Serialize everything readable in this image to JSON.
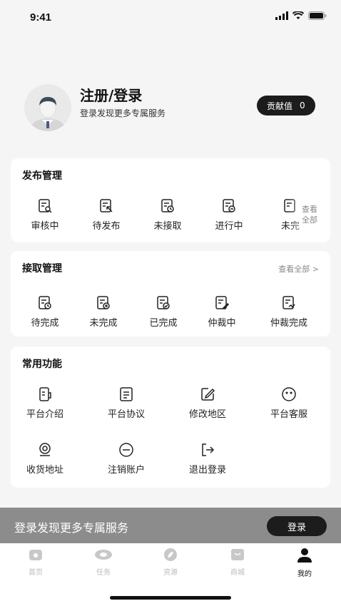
{
  "status_bar": {
    "time": "9:41"
  },
  "profile": {
    "title": "注册/登录",
    "subtitle": "登录发现更多专属服务",
    "contribution_label": "贡献值",
    "contribution_value": "0"
  },
  "publish": {
    "title": "发布管理",
    "side_more": [
      "查看",
      "全部"
    ],
    "items": [
      {
        "label": "审核中",
        "icon": "doc-search-icon"
      },
      {
        "label": "待发布",
        "icon": "doc-cursor-icon"
      },
      {
        "label": "未接取",
        "icon": "doc-clock-icon"
      },
      {
        "label": "进行中",
        "icon": "doc-progress-icon"
      },
      {
        "label": "未完",
        "icon": "doc-icon"
      }
    ]
  },
  "receive": {
    "title": "接取管理",
    "more": "查看全部 >",
    "items": [
      {
        "label": "待完成",
        "icon": "doc-clock-icon"
      },
      {
        "label": "未完成",
        "icon": "doc-x-icon"
      },
      {
        "label": "已完成",
        "icon": "doc-check-icon"
      },
      {
        "label": "仲裁中",
        "icon": "doc-edit-icon"
      },
      {
        "label": "仲裁完成",
        "icon": "doc-signed-icon"
      }
    ]
  },
  "common": {
    "title": "常用功能",
    "items": [
      {
        "label": "平台介绍",
        "icon": "info-doc-icon"
      },
      {
        "label": "平台协议",
        "icon": "agreement-icon"
      },
      {
        "label": "修改地区",
        "icon": "edit-icon"
      },
      {
        "label": "平台客服",
        "icon": "service-icon"
      },
      {
        "label": "收货地址",
        "icon": "location-icon"
      },
      {
        "label": "注销账户",
        "icon": "minus-circle-icon"
      },
      {
        "label": "退出登录",
        "icon": "logout-icon"
      }
    ]
  },
  "promo": {
    "text": "登录发现更多专属服务",
    "button": "登录"
  },
  "tabbar": {
    "items": [
      {
        "label": "首页",
        "icon": "home-icon",
        "active": false
      },
      {
        "label": "任务",
        "icon": "task-icon",
        "active": false
      },
      {
        "label": "资源",
        "icon": "resource-icon",
        "active": false
      },
      {
        "label": "商城",
        "icon": "shop-icon",
        "active": false
      },
      {
        "label": "我的",
        "icon": "user-icon",
        "active": true
      }
    ]
  }
}
